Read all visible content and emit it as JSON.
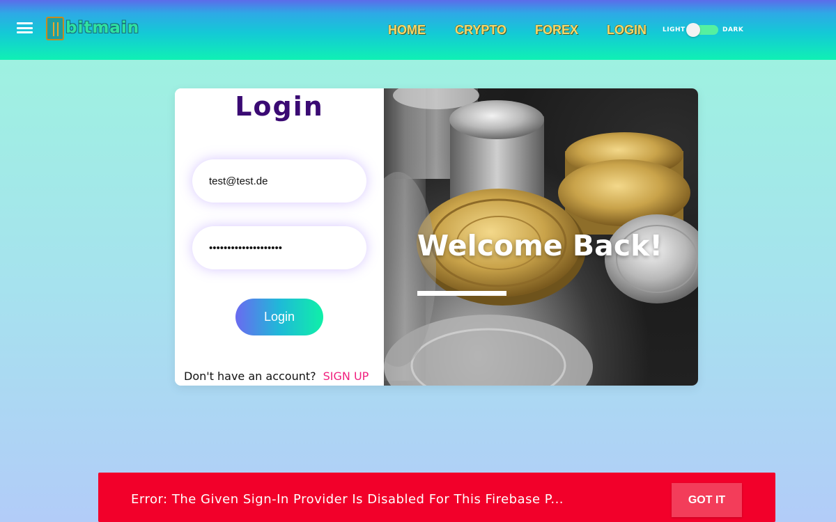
{
  "header": {
    "logo_text": "bitmain",
    "nav": {
      "home": "HOME",
      "crypto": "CRYPTO",
      "forex": "FOREX",
      "login": "LOGIN"
    },
    "theme_toggle": {
      "light_label": "LIGHT",
      "dark_label": "DARK",
      "state": "light"
    }
  },
  "login_form": {
    "title": "Login",
    "email_value": "test@test.de",
    "password_value": "••••••••••••••••••••",
    "login_button_label": "Login",
    "signup_prompt": "Don't have an account?",
    "signup_link_label": "SIGN UP"
  },
  "hero": {
    "welcome_text": "Welcome Back!"
  },
  "error_banner": {
    "message": "Error: The Given Sign-In Provider Is Disabled For This Firebase P...",
    "dismiss_label": "GOT IT"
  },
  "colors": {
    "title_purple": "#3a0a73",
    "signup_pink": "#f0207e",
    "error_red": "#f2002a",
    "nav_yellow": "#f4d86a"
  }
}
